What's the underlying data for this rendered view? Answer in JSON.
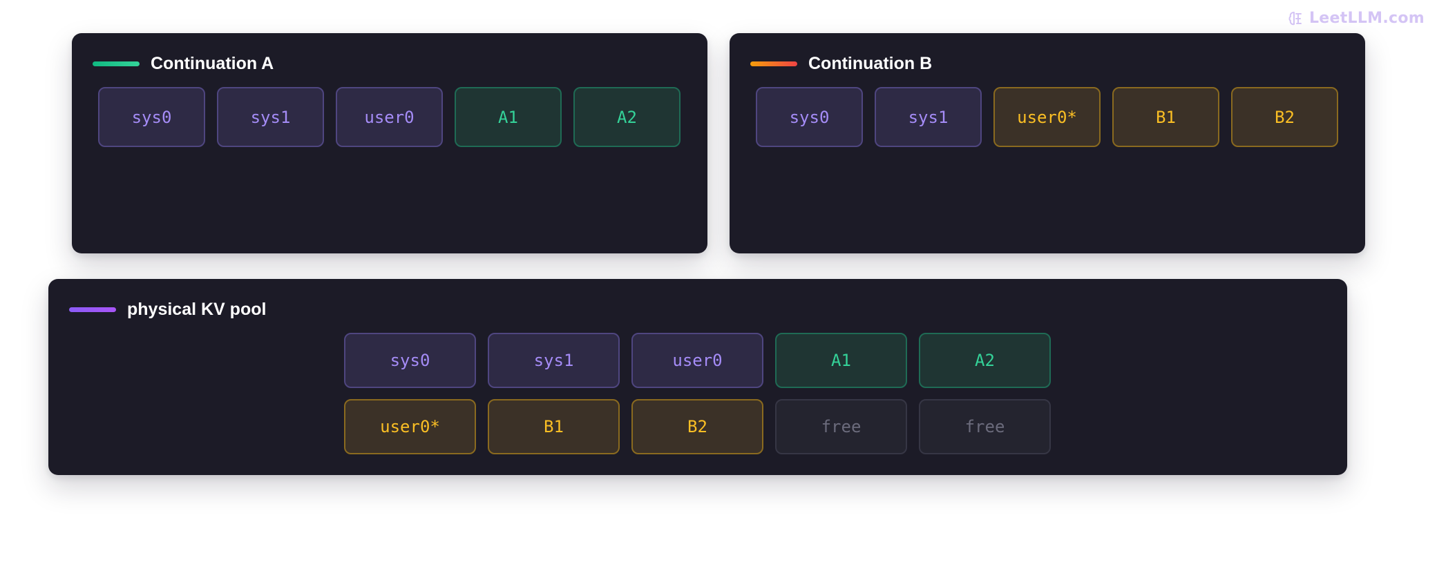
{
  "watermark": {
    "text": "LeetLLM.com",
    "icon": "brain-icon",
    "color": "#d4c4f5"
  },
  "colors": {
    "panel_bg": "#1c1b27",
    "shared": "#a58cf7",
    "branch_a": "#34d399",
    "branch_b": "#fbbf24",
    "free": "#6b6b7c"
  },
  "continuation_a": {
    "title": "Continuation A",
    "accent": "#10b981",
    "blocks": [
      {
        "label": "sys0",
        "kind": "shared"
      },
      {
        "label": "sys1",
        "kind": "shared"
      },
      {
        "label": "user0",
        "kind": "shared"
      },
      {
        "label": "A1",
        "kind": "branch-a"
      },
      {
        "label": "A2",
        "kind": "branch-a"
      }
    ]
  },
  "continuation_b": {
    "title": "Continuation B",
    "accent": "#f97316",
    "blocks": [
      {
        "label": "sys0",
        "kind": "shared"
      },
      {
        "label": "sys1",
        "kind": "shared"
      },
      {
        "label": "user0*",
        "kind": "branch-b"
      },
      {
        "label": "B1",
        "kind": "branch-b"
      },
      {
        "label": "B2",
        "kind": "branch-b"
      }
    ]
  },
  "physical_pool": {
    "title": "physical KV pool",
    "accent": "#8b5cf6",
    "blocks": [
      {
        "label": "sys0",
        "kind": "shared"
      },
      {
        "label": "sys1",
        "kind": "shared"
      },
      {
        "label": "user0",
        "kind": "shared"
      },
      {
        "label": "A1",
        "kind": "branch-a"
      },
      {
        "label": "A2",
        "kind": "branch-a"
      },
      {
        "label": "user0*",
        "kind": "branch-b"
      },
      {
        "label": "B1",
        "kind": "branch-b"
      },
      {
        "label": "B2",
        "kind": "branch-b"
      },
      {
        "label": "free",
        "kind": "free"
      },
      {
        "label": "free",
        "kind": "free"
      }
    ]
  }
}
